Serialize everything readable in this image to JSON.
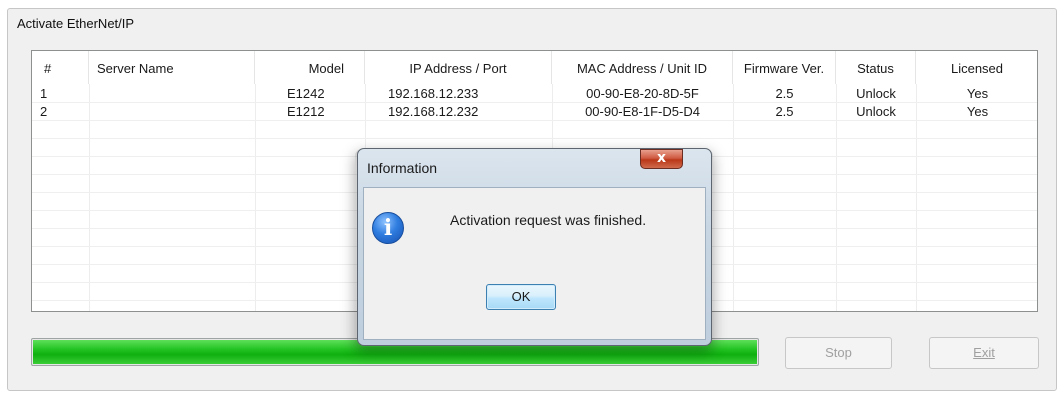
{
  "window": {
    "group_title": "Activate EtherNet/IP"
  },
  "table": {
    "columns": [
      "#",
      "Server Name",
      "Model",
      "IP Address / Port",
      "MAC Address / Unit ID",
      "Firmware Ver.",
      "Status",
      "Licensed"
    ],
    "rows": [
      {
        "num": "1",
        "server_name": "",
        "model": "E1242",
        "ip": "192.168.12.233",
        "mac": "00-90-E8-20-8D-5F",
        "firmware": "2.5",
        "status": "Unlock",
        "licensed": "Yes"
      },
      {
        "num": "2",
        "server_name": "",
        "model": "E1212",
        "ip": "192.168.12.232",
        "mac": "00-90-E8-1F-D5-D4",
        "firmware": "2.5",
        "status": "Unlock",
        "licensed": "Yes"
      }
    ]
  },
  "progress": {
    "value_percent": 100,
    "color": "#1cbf1c"
  },
  "buttons": {
    "stop": "Stop",
    "exit": "Exit"
  },
  "dialog": {
    "title": "Information",
    "close_glyph": "x",
    "icon": "info-icon",
    "icon_glyph": "i",
    "message": "Activation request was finished.",
    "ok": "OK"
  }
}
